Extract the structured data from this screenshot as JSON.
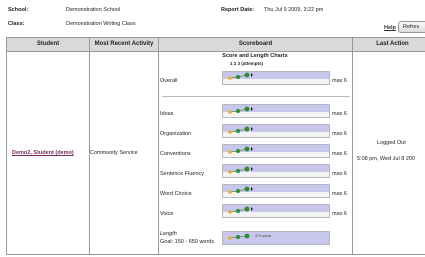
{
  "header": {
    "school_label": "School:",
    "school_value": "Demonstration School",
    "class_label": "Class:",
    "class_value": "Demonstration Writing Class",
    "report_date_label": "Report Date:",
    "report_date_value": "Thu Jul 9 2009, 3:22 pm",
    "help_label": "Help",
    "refresh_label": "Refres"
  },
  "table": {
    "columns": [
      "Student",
      "Most Recent Activity",
      "Scoreboard",
      "Last Action"
    ],
    "row": {
      "student": "Demo2, Student (demo)",
      "activity": "Community Service",
      "last_action_line1": "Logged Out",
      "last_action_line2": "5:08 pm, Wed Jul 8 200"
    }
  },
  "scoreboard": {
    "title": "Score and Length Charts",
    "tick_labels": "1  2  3  (attempts)",
    "traits": [
      {
        "label": "Overall",
        "max": "max 6"
      },
      {
        "label": "Ideas",
        "max": "max 6"
      },
      {
        "label": "Organization",
        "max": "max 6"
      },
      {
        "label": "Conventions",
        "max": "max 6"
      },
      {
        "label": "Sentence Fluency",
        "max": "max 6"
      },
      {
        "label": "Word Choice",
        "max": "max 6"
      },
      {
        "label": "Voice",
        "max": "max 6"
      }
    ],
    "length_label": "Length",
    "goal_label": "Goal:  150 - 650 words",
    "length_value_text": "470 words"
  },
  "colors": {
    "header_bg": "#d9d9d9",
    "band": "#c7c7ec",
    "first_attempt": "#f0a830",
    "later_attempt": "#2e8b2e",
    "link": "#7a2a5a"
  }
}
